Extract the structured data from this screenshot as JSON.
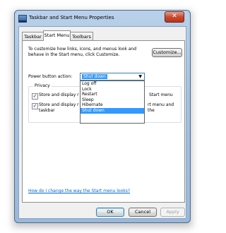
{
  "window": {
    "title": "Taskbar and Start Menu Properties",
    "close_glyph": "✕"
  },
  "tabs": [
    {
      "label": "Taskbar"
    },
    {
      "label": "Start Menu"
    },
    {
      "label": "Toolbars"
    }
  ],
  "start_menu": {
    "description": "To customize how links, icons, and menus look and behave in the Start menu, click Customize.",
    "customize_button": "Customize...",
    "power_label": "Power button action:",
    "power_value": "Shut down",
    "power_options": [
      "Log off",
      "Lock",
      "Restart",
      "Sleep",
      "Hibernate",
      "Shut down"
    ],
    "privacy": {
      "label": "Privacy",
      "items": [
        {
          "checked": true,
          "text_left": "Store and display r",
          "text_right": "Start menu"
        },
        {
          "checked": true,
          "text_left": "Store and display r",
          "text_right": "rt menu and the",
          "text_line2": "taskbar"
        }
      ]
    },
    "help_link": "How do I change the way the Start menu looks?"
  },
  "footer": {
    "ok": "OK",
    "cancel": "Cancel",
    "apply": "Apply"
  },
  "colors": {
    "selection": "#3399ff",
    "link": "#0066cc",
    "close": "#c74a2f"
  }
}
